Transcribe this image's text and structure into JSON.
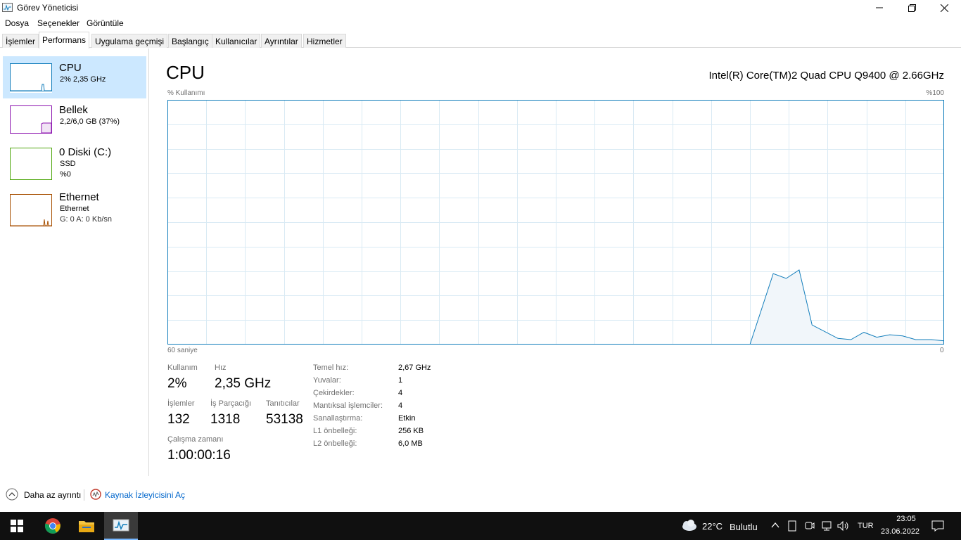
{
  "window": {
    "title": "Görev Yöneticisi"
  },
  "menu": [
    "Dosya",
    "Seçenekler",
    "Görüntüle"
  ],
  "tabs": [
    "İşlemler",
    "Performans",
    "Uygulama geçmişi",
    "Başlangıç",
    "Kullanıcılar",
    "Ayrıntılar",
    "Hizmetler"
  ],
  "active_tab": "Performans",
  "sidebar": {
    "items": [
      {
        "title": "CPU",
        "sub1": "2% 2,35 GHz",
        "sub2": "",
        "color": "#117dbb",
        "selected": true
      },
      {
        "title": "Bellek",
        "sub1": "2,2/6,0 GB (37%)",
        "sub2": "",
        "color": "#8b12ae",
        "selected": false
      },
      {
        "title": "0 Diski (C:)",
        "sub1": "SSD",
        "sub2": "%0",
        "color": "#4da60c",
        "selected": false
      },
      {
        "title": "Ethernet",
        "sub1": "Ethernet",
        "sub2": "G: 0 A: 0 Kb/sn",
        "color": "#a74f01",
        "selected": false
      }
    ]
  },
  "main": {
    "title": "CPU",
    "model": "Intel(R) Core(TM)2 Quad CPU Q9400 @ 2.66GHz",
    "graph_label_left": "% Kullanımı",
    "graph_label_right": "%100",
    "graph_bottom_left": "60 saniye",
    "graph_bottom_right": "0",
    "stats": {
      "usage_label": "Kullanım",
      "usage_value": "2%",
      "speed_label": "Hız",
      "speed_value": "2,35 GHz",
      "processes_label": "İşlemler",
      "processes_value": "132",
      "threads_label": "İş Parçacığı",
      "threads_value": "1318",
      "handles_label": "Tanıtıcılar",
      "handles_value": "53138",
      "uptime_label": "Çalışma zamanı",
      "uptime_value": "1:00:00:16"
    },
    "details": [
      {
        "label": "Temel hız:",
        "value": "2,67 GHz"
      },
      {
        "label": "Yuvalar:",
        "value": "1"
      },
      {
        "label": "Çekirdekler:",
        "value": "4"
      },
      {
        "label": "Mantıksal işlemciler:",
        "value": "4"
      },
      {
        "label": "Sanallaştırma:",
        "value": "Etkin"
      },
      {
        "label": "L1 önbelleği:",
        "value": "256 KB"
      },
      {
        "label": "L2 önbelleği:",
        "value": "6,0 MB"
      }
    ]
  },
  "chart_data": {
    "type": "area",
    "x_unit": "seconds ago",
    "xlim": [
      60,
      0
    ],
    "ylim": [
      0,
      100
    ],
    "grid": true,
    "color": "#117dbb",
    "x": [
      60,
      15,
      13.2,
      12.2,
      11.2,
      10.2,
      8.2,
      7.2,
      6.2,
      5.2,
      4.2,
      3.2,
      2.2,
      1,
      0
    ],
    "values": [
      0,
      0,
      29,
      27,
      30.5,
      8,
      2.5,
      2,
      5,
      3,
      4,
      3.5,
      2,
      2,
      1.5
    ]
  },
  "footer": {
    "less_details": "Daha az ayrıntı",
    "resource_monitor": "Kaynak İzleyicisini Aç"
  },
  "taskbar": {
    "weather_temp": "22°C",
    "weather_desc": "Bulutlu",
    "language": "TUR",
    "time": "23:05",
    "date": "23.06.2022"
  }
}
